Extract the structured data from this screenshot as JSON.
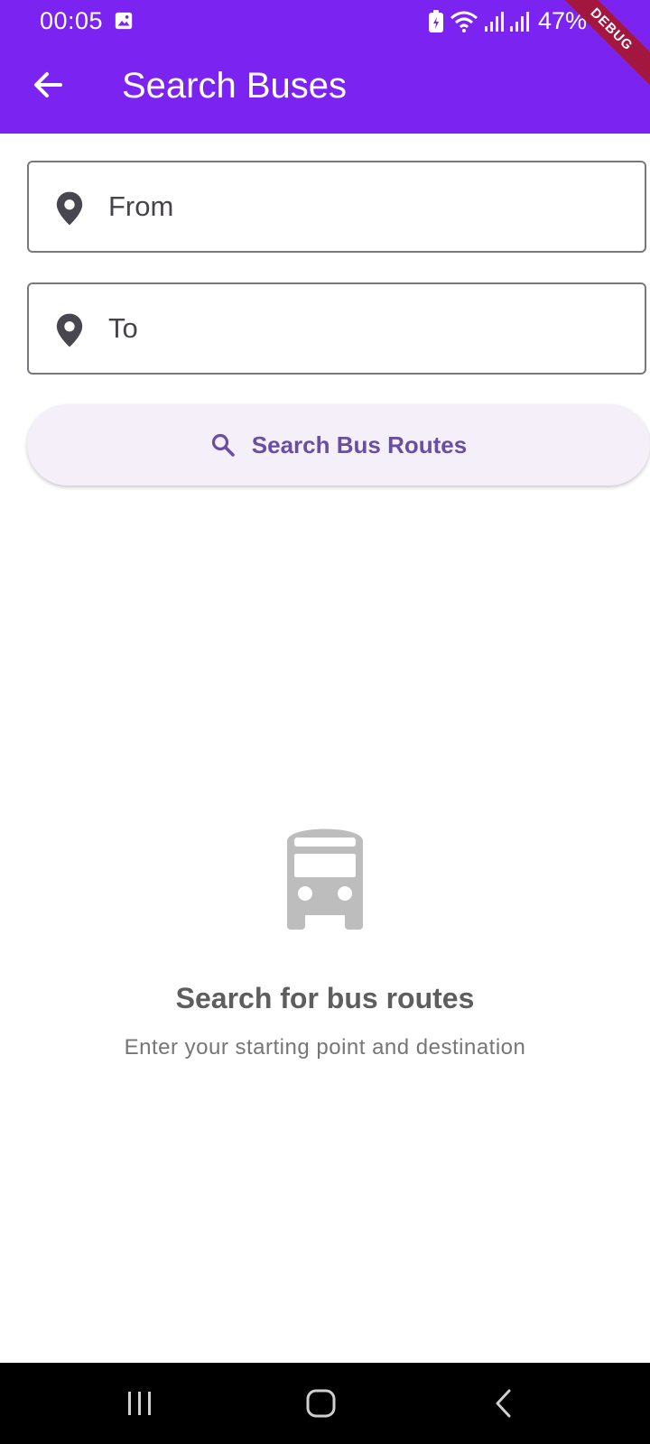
{
  "status_bar": {
    "time": "00:05",
    "battery": "47%",
    "gallery_icon": "image-icon",
    "debug_label": "DEBUG"
  },
  "appbar": {
    "title": "Search Buses",
    "back_icon": "arrow-back-icon",
    "background_color": "#7b23f0"
  },
  "form": {
    "from": {
      "placeholder": "From",
      "value": "",
      "icon": "location-pin-icon"
    },
    "to": {
      "placeholder": "To",
      "value": "",
      "icon": "location-pin-icon"
    },
    "search_button": {
      "label": "Search Bus Routes",
      "icon": "search-icon",
      "text_color": "#6a4ea0",
      "background_color": "#f4eff8"
    }
  },
  "empty_state": {
    "icon": "bus-icon",
    "title": "Search for bus routes",
    "subtitle": "Enter your starting point and destination"
  },
  "system_nav": {
    "recent": "recent-apps-icon",
    "home": "home-icon",
    "back": "back-icon"
  }
}
